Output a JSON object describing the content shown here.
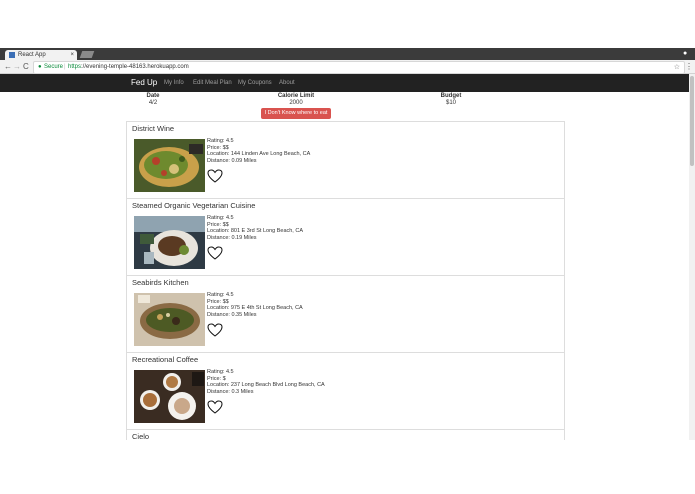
{
  "browser": {
    "tab_title": "React App",
    "tab_close": "×",
    "secure_label": "Secure",
    "url_scheme": "https",
    "url_rest": "://evening-temple-48163.herokuapp.com",
    "lock_glyph": "🔒",
    "back_glyph": "←",
    "forward_glyph": "→",
    "reload_glyph": "C",
    "star_glyph": "☆",
    "menu_glyph": "⋮",
    "user_glyph": "●"
  },
  "navbar": {
    "brand": "Fed Up",
    "links": [
      "My Info",
      "Edit Meal Plan",
      "My Coupons",
      "About"
    ]
  },
  "summary": {
    "date_label": "Date",
    "date_value": "4/2",
    "calorie_label": "Calorie Limit",
    "calorie_value": "2000",
    "budget_label": "Budget",
    "budget_value": "$10",
    "random_button": "I Don't Know where to eat"
  },
  "restaurants": [
    {
      "name": "District Wine",
      "rating": "Rating: 4.5",
      "price": "Price: $$",
      "location": "Location: 144 Linden Ave Long Beach, CA",
      "distance": "Distance: 0.09 Miles",
      "photo": "flatbread-pizza-photo"
    },
    {
      "name": "Steamed Organic Vegetarian Cuisine",
      "rating": "Rating: 4.5",
      "price": "Price: $$",
      "location": "Location: 801 E 3rd St Long Beach, CA",
      "distance": "Distance: 0.19 Miles",
      "photo": "vegetarian-plate-photo"
    },
    {
      "name": "Seabirds Kitchen",
      "rating": "Rating: 4.5",
      "price": "Price: $$",
      "location": "Location: 975 E 4th St Long Beach, CA",
      "distance": "Distance: 0.35 Miles",
      "photo": "salad-bowl-photo"
    },
    {
      "name": "Recreational Coffee",
      "rating": "Rating: 4.5",
      "price": "Price: $",
      "location": "Location: 237 Long Beach Blvd Long Beach, CA",
      "distance": "Distance: 0.3 Miles",
      "photo": "coffee-cups-photo"
    },
    {
      "name": "Cielo"
    }
  ],
  "colors": {
    "navbar_bg": "#222222",
    "button_red": "#d9534f",
    "secure_green": "#0a8a3a"
  }
}
